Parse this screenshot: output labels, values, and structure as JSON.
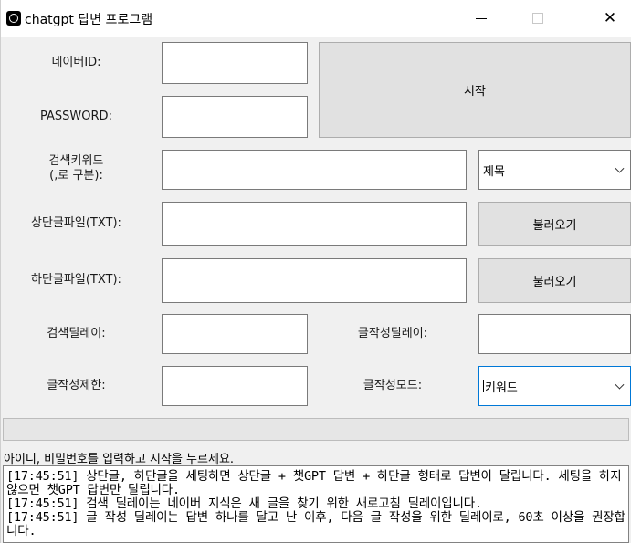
{
  "window": {
    "title": "chatgpt 답변 프로그램"
  },
  "labels": {
    "naver_id": "네이버ID:",
    "password": "PASSWORD:",
    "search_keyword_line1": "검색키워드",
    "search_keyword_line2": "(,로 구분):",
    "top_file": "상단글파일(TXT):",
    "bottom_file": "하단글파일(TXT):",
    "search_delay": "검색딜레이:",
    "write_delay": "글작성딜레이:",
    "write_limit": "글작성제한:",
    "write_mode": "글작성모드:"
  },
  "inputs": {
    "naver_id": "",
    "password": "",
    "search_keyword": "",
    "top_file": "",
    "bottom_file": "",
    "search_delay": "",
    "write_delay": "",
    "write_limit": ""
  },
  "buttons": {
    "start": "시작",
    "load_top": "불러오기",
    "load_bottom": "불러오기"
  },
  "selects": {
    "keyword_target": "제목",
    "write_mode": "키워드"
  },
  "progress": {
    "value": 0
  },
  "status_text": "아이디, 비밀번호를 입력하고 시작을 누르세요.",
  "log_lines": [
    "[17:45:51] 상단글, 하단글을 세팅하면 상단글 + 챗GPT 답변 + 하단글 형태로 답변이 달립니다. 세팅을 하지 않으면 챗GPT 답변만 달립니다.",
    "[17:45:51] 검색 딜레이는 네이버 지식은 새 글을 찾기 위한 새로고침 딜레이입니다.",
    "[17:45:51] 글 작성 딜레이는 답변 하나를 달고 난 이후, 다음 글 작성을 위한 딜레이로, 60초 이상을 권장합니다."
  ]
}
